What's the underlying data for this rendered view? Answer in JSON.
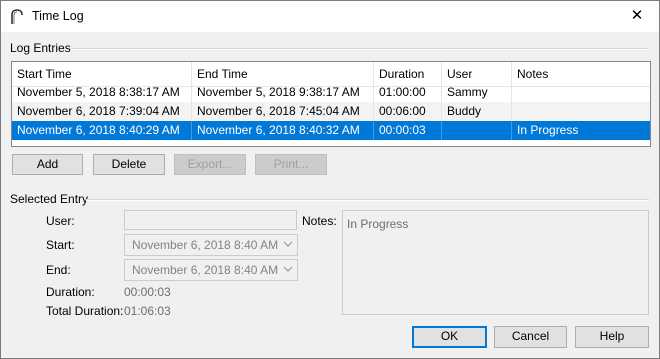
{
  "window": {
    "title": "Time Log",
    "close_glyph": "✕"
  },
  "log_entries": {
    "group_label": "Log Entries",
    "columns": [
      "Start Time",
      "End Time",
      "Duration",
      "User",
      "Notes"
    ],
    "rows": [
      [
        "November 5, 2018 8:38:17 AM",
        "November 5, 2018 9:38:17 AM",
        "01:00:00",
        "Sammy",
        ""
      ],
      [
        "November 6, 2018 7:39:04 AM",
        "November 6, 2018 7:45:04 AM",
        "00:06:00",
        "Buddy",
        ""
      ],
      [
        "November 6, 2018 8:40:29 AM",
        "November 6, 2018 8:40:32 AM",
        "00:00:03",
        "",
        "In Progress"
      ]
    ],
    "selected_row": 2
  },
  "buttons": {
    "add": "Add",
    "delete": "Delete",
    "export": "Export...",
    "print": "Print...",
    "ok": "OK",
    "cancel": "Cancel",
    "help": "Help"
  },
  "selected_entry": {
    "group_label": "Selected Entry",
    "user_label": "User:",
    "user_value": "",
    "start_label": "Start:",
    "start_value": "November 6, 2018 8:40 AM",
    "end_label": "End:",
    "end_value": "November 6, 2018 8:40 AM",
    "duration_label": "Duration:",
    "duration_value": "00:00:03",
    "total_duration_label": "Total Duration:",
    "total_duration_value": "01:06:03",
    "notes_label": "Notes:",
    "notes_value": "In Progress"
  },
  "colors": {
    "selection": "#0078d7",
    "default_button_border": "#0078d7"
  },
  "icons": {
    "app": "arch-icon",
    "close": "close-icon",
    "dropdown": "chevron-down-icon"
  }
}
